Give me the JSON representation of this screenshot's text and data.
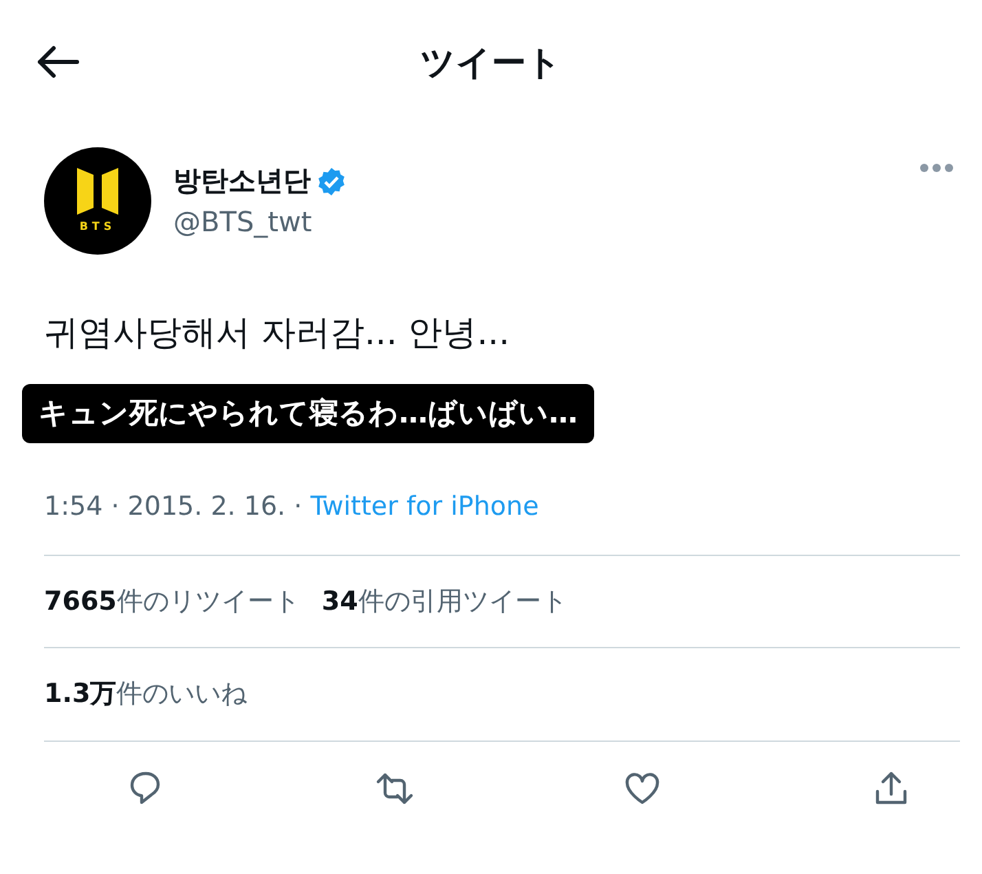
{
  "header": {
    "title": "ツイート"
  },
  "author": {
    "avatar_text": "BTS",
    "name": "방탄소년단",
    "verified": true,
    "handle": "@BTS_twt"
  },
  "tweet": {
    "text": "귀염사당해서 자러감... 안녕..."
  },
  "caption": "キュン死にやられて寝るわ…ばいばい…",
  "meta": {
    "time": "1:54 · 2015. 2. 16. · ",
    "source": "Twitter for iPhone"
  },
  "stats": [
    "**7665**件のリツイート",
    "**34**件の引用ツイート"
  ],
  "likes": "**1.3万**件のいいね",
  "actions": [
    {
      "kind": "reply"
    },
    {
      "kind": "retweet"
    },
    {
      "kind": "like"
    },
    {
      "kind": "share"
    }
  ]
}
